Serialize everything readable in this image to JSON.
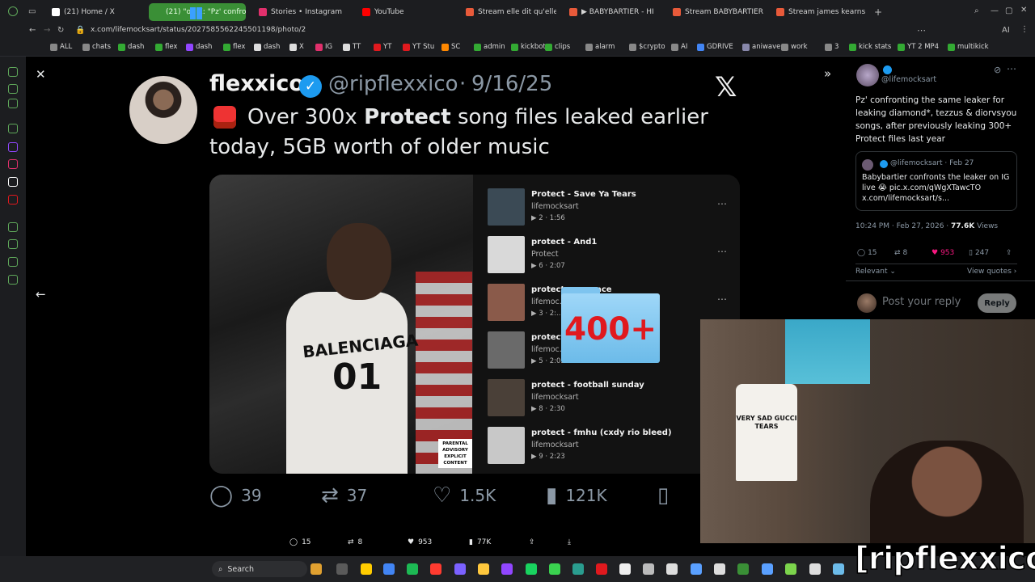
{
  "browser": {
    "tabs": [
      {
        "label": "(21) Home / X",
        "favicon": "x-icon",
        "color": "#ffffff"
      },
      {
        "label": "(21) \"on X: \"Pz' confront",
        "favicon": "x-icon",
        "color": "#3a8f36",
        "active": true
      },
      {
        "label": "Stories • Instagram",
        "favicon": "instagram-icon",
        "color": "#e1306c"
      },
      {
        "label": "YouTube",
        "favicon": "youtube-icon",
        "color": "#ff0000"
      },
      {
        "label": "Stream elle dit qu'elle trou",
        "favicon": "stream-icon",
        "color": "#e85a3a"
      },
      {
        "label": "▶ BABYBARTIER - HI",
        "favicon": "stream-icon",
        "color": "#e85a3a"
      },
      {
        "label": "Stream BABYBARTIER - V",
        "favicon": "stream-icon",
        "color": "#e85a3a"
      },
      {
        "label": "Stream james kearns (hoff",
        "favicon": "stream-icon",
        "color": "#e85a3a"
      }
    ],
    "url": "x.com/lifemocksart/status/2027585562245501198/photo/2",
    "bookmarks": [
      "ALL",
      "chats",
      "dash",
      "flex",
      "dash",
      "flex",
      "dash",
      "X",
      "IG",
      "TT",
      "YT",
      "YT Stu",
      "SC",
      "admin",
      "kickbot",
      "clips",
      "alarm",
      "$crypto",
      "AI",
      "GDRIVE",
      "aniwave",
      "work",
      "3",
      "kick stats",
      "YT 2 MP4",
      "multikick"
    ]
  },
  "tweet": {
    "display_name": "flexxico",
    "handle": "@ripflexxico",
    "dot": "·",
    "date": "9/16/25",
    "text_before": "Over 300x ",
    "text_bold": "Protect",
    "text_after": " song files leaked earlier today, 5GB worth of older music",
    "x_logo": "𝕏"
  },
  "playlist": [
    {
      "title": "Protect - Save Ya Tears",
      "artist": "lifemocksart",
      "meta": "▶ 2 · 1:56",
      "thumb": "#3b4a55"
    },
    {
      "title": "protect - And1",
      "artist": "Protect",
      "meta": "▶ 6 · 2:07",
      "thumb": "#d9d9d9"
    },
    {
      "title": "protect - ...wance",
      "artist": "lifemoc...",
      "meta": "▶ 3 · 2:...",
      "thumb": "#8a5a4a"
    },
    {
      "title": "protect - ... jade)",
      "artist": "lifemoc...",
      "meta": "▶ 5 · 2:05",
      "thumb": "#6a6a6a"
    },
    {
      "title": "protect - football sunday",
      "artist": "lifemocksart",
      "meta": "▶ 8 · 2:30",
      "thumb": "#4a4038"
    },
    {
      "title": "protect - fmhu (cxdy rio bleed)",
      "artist": "lifemocksart",
      "meta": "▶ 9 · 2:23",
      "thumb": "#c8c8c8"
    }
  ],
  "folder_overlay": "400+",
  "photo": {
    "shirt_text": "BALENCIAGA",
    "shirt_number": "01",
    "advisory": "PARENTAL ADVISORY EXPLICIT CONTENT"
  },
  "actions": {
    "replies": "39",
    "retweets": "37",
    "likes": "1.5K",
    "views": "121K"
  },
  "bottom_actions": {
    "replies": "15",
    "retweets": "8",
    "likes": "953",
    "views": "77K"
  },
  "right_panel": {
    "handle": "@lifemocksart",
    "text": "Pz' confronting the same leaker for leaking diamond*, tezzus & diorvsyou songs, after previously leaking 300+ Protect files last year",
    "quote_handle": "@lifemocksart · Feb 27",
    "quote_text": "Babybartier confronts the leaker on IG live 😭 pic.x.com/qWgXTawcTO x.com/lifemocksart/s...",
    "time": "10:24 PM · Feb 27, 2026 · ",
    "views_count": "77.6K",
    "views_label": " Views",
    "stats": {
      "replies": "15",
      "retweets": "8",
      "likes": "953",
      "bookmarks": "247"
    },
    "relevant": "Relevant ⌄",
    "view_quotes": "View quotes ›",
    "reply_placeholder": "Post your reply",
    "reply_button": "Reply"
  },
  "webcam": {
    "shirt_text": "VERY SAD GUCCI TEARS",
    "caption": "[ripflexxico]"
  },
  "taskbar": {
    "search": "Search"
  }
}
